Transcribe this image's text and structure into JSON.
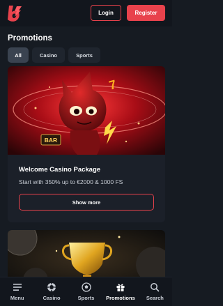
{
  "header": {
    "login_label": "Login",
    "register_label": "Register",
    "brand_color": "#e8424c"
  },
  "page": {
    "title": "Promotions"
  },
  "tabs": [
    {
      "label": "All",
      "active": true
    },
    {
      "label": "Casino",
      "active": false
    },
    {
      "label": "Sports",
      "active": false
    }
  ],
  "promo": {
    "image_sign": "BAR",
    "title": "Welcome Casino Package",
    "description": "Start with 350% up to €2000 & 1000 FS",
    "button_label": "Show more"
  },
  "bottom_nav": [
    {
      "label": "Menu",
      "icon": "menu-icon"
    },
    {
      "label": "Casino",
      "icon": "casino-chip-icon"
    },
    {
      "label": "Sports",
      "icon": "soccer-ball-icon"
    },
    {
      "label": "Promotions",
      "icon": "gift-icon",
      "active": true
    },
    {
      "label": "Search",
      "icon": "search-icon"
    }
  ]
}
